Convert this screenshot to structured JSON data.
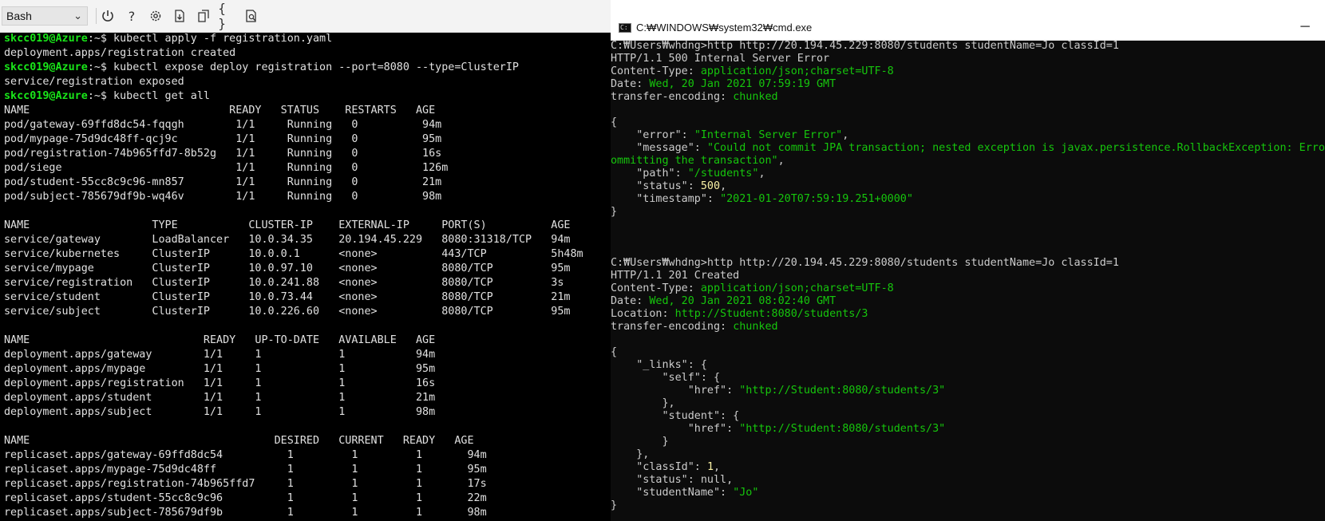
{
  "cloudshell": {
    "shell_select": "Bash",
    "toolbar_icons": [
      "power-icon",
      "help-icon",
      "settings-icon",
      "upload-download-icon",
      "open-new-session-icon",
      "editor-braces-icon",
      "web-preview-icon"
    ],
    "prompt_user": "skcc019@Azure",
    "prompt_path": ":~$ ",
    "lines": [
      {
        "type": "prompt",
        "cmd": "kubectl apply -f registration.yaml"
      },
      {
        "type": "out",
        "text": "deployment.apps/registration created"
      },
      {
        "type": "prompt",
        "cmd": "kubectl expose deploy registration --port=8080 --type=ClusterIP"
      },
      {
        "type": "out",
        "text": "service/registration exposed"
      },
      {
        "type": "prompt",
        "cmd": "kubectl get all"
      },
      {
        "type": "out",
        "text": "NAME                               READY   STATUS    RESTARTS   AGE"
      },
      {
        "type": "out",
        "text": "pod/gateway-69ffd8dc54-fqqgh        1/1     Running   0          94m"
      },
      {
        "type": "out",
        "text": "pod/mypage-75d9dc48ff-qcj9c         1/1     Running   0          95m"
      },
      {
        "type": "out",
        "text": "pod/registration-74b965ffd7-8b52g   1/1     Running   0          16s"
      },
      {
        "type": "out",
        "text": "pod/siege                           1/1     Running   0          126m"
      },
      {
        "type": "out",
        "text": "pod/student-55cc8c9c96-mn857        1/1     Running   0          21m"
      },
      {
        "type": "out",
        "text": "pod/subject-785679df9b-wq46v        1/1     Running   0          98m"
      },
      {
        "type": "out",
        "text": ""
      },
      {
        "type": "out",
        "text": "NAME                   TYPE           CLUSTER-IP    EXTERNAL-IP     PORT(S)          AGE"
      },
      {
        "type": "out",
        "text": "service/gateway        LoadBalancer   10.0.34.35    20.194.45.229   8080:31318/TCP   94m"
      },
      {
        "type": "out",
        "text": "service/kubernetes     ClusterIP      10.0.0.1      <none>          443/TCP          5h48m"
      },
      {
        "type": "out",
        "text": "service/mypage         ClusterIP      10.0.97.10    <none>          8080/TCP         95m"
      },
      {
        "type": "out",
        "text": "service/registration   ClusterIP      10.0.241.88   <none>          8080/TCP         3s"
      },
      {
        "type": "out",
        "text": "service/student        ClusterIP      10.0.73.44    <none>          8080/TCP         21m"
      },
      {
        "type": "out",
        "text": "service/subject        ClusterIP      10.0.226.60   <none>          8080/TCP         95m"
      },
      {
        "type": "out",
        "text": ""
      },
      {
        "type": "out",
        "text": "NAME                           READY   UP-TO-DATE   AVAILABLE   AGE"
      },
      {
        "type": "out",
        "text": "deployment.apps/gateway        1/1     1            1           94m"
      },
      {
        "type": "out",
        "text": "deployment.apps/mypage         1/1     1            1           95m"
      },
      {
        "type": "out",
        "text": "deployment.apps/registration   1/1     1            1           16s"
      },
      {
        "type": "out",
        "text": "deployment.apps/student        1/1     1            1           21m"
      },
      {
        "type": "out",
        "text": "deployment.apps/subject        1/1     1            1           98m"
      },
      {
        "type": "out",
        "text": ""
      },
      {
        "type": "out",
        "text": "NAME                                      DESIRED   CURRENT   READY   AGE"
      },
      {
        "type": "out",
        "text": "replicaset.apps/gateway-69ffd8dc54          1         1         1       94m"
      },
      {
        "type": "out",
        "text": "replicaset.apps/mypage-75d9dc48ff           1         1         1       95m"
      },
      {
        "type": "out",
        "text": "replicaset.apps/registration-74b965ffd7     1         1         1       17s"
      },
      {
        "type": "out",
        "text": "replicaset.apps/student-55cc8c9c96          1         1         1       22m"
      },
      {
        "type": "out",
        "text": "replicaset.apps/subject-785679df9b          1         1         1       98m"
      }
    ]
  },
  "cmd": {
    "title": "C:₩WINDOWS₩system32₩cmd.exe",
    "minimize": "─",
    "lines": [
      [
        {
          "c": "w",
          "t": "C:₩Users₩whdng>http http://20.194.45.229:8080/students studentName=Jo classId=1"
        }
      ],
      [
        {
          "c": "w",
          "t": "HTTP/1.1 500 Internal Server Error"
        }
      ],
      [
        {
          "c": "w",
          "t": "Content-Type: "
        },
        {
          "c": "g",
          "t": "application/json;charset=UTF-8"
        }
      ],
      [
        {
          "c": "w",
          "t": "Date: "
        },
        {
          "c": "g",
          "t": "Wed, 20 Jan 2021 07:59:19 GMT"
        }
      ],
      [
        {
          "c": "w",
          "t": "transfer-encoding: "
        },
        {
          "c": "g",
          "t": "chunked"
        }
      ],
      [
        {
          "c": "w",
          "t": ""
        }
      ],
      [
        {
          "c": "w",
          "t": "{"
        }
      ],
      [
        {
          "c": "w",
          "t": "    \"error\": "
        },
        {
          "c": "g",
          "t": "\"Internal Server Error\""
        },
        {
          "c": "w",
          "t": ","
        }
      ],
      [
        {
          "c": "w",
          "t": "    \"message\": "
        },
        {
          "c": "g",
          "t": "\"Could not commit JPA transaction; nested exception is javax.persistence.RollbackException: Error while c"
        }
      ],
      [
        {
          "c": "g",
          "t": "ommitting the transaction\""
        },
        {
          "c": "w",
          "t": ","
        }
      ],
      [
        {
          "c": "w",
          "t": "    \"path\": "
        },
        {
          "c": "g",
          "t": "\"/students\""
        },
        {
          "c": "w",
          "t": ","
        }
      ],
      [
        {
          "c": "w",
          "t": "    \"status\": "
        },
        {
          "c": "y",
          "t": "500"
        },
        {
          "c": "w",
          "t": ","
        }
      ],
      [
        {
          "c": "w",
          "t": "    \"timestamp\": "
        },
        {
          "c": "g",
          "t": "\"2021-01-20T07:59:19.251+0000\""
        }
      ],
      [
        {
          "c": "w",
          "t": "}"
        }
      ],
      [
        {
          "c": "w",
          "t": ""
        }
      ],
      [
        {
          "c": "w",
          "t": ""
        }
      ],
      [
        {
          "c": "w",
          "t": ""
        }
      ],
      [
        {
          "c": "w",
          "t": "C:₩Users₩whdng>http http://20.194.45.229:8080/students studentName=Jo classId=1"
        }
      ],
      [
        {
          "c": "w",
          "t": "HTTP/1.1 201 Created"
        }
      ],
      [
        {
          "c": "w",
          "t": "Content-Type: "
        },
        {
          "c": "g",
          "t": "application/json;charset=UTF-8"
        }
      ],
      [
        {
          "c": "w",
          "t": "Date: "
        },
        {
          "c": "g",
          "t": "Wed, 20 Jan 2021 08:02:40 GMT"
        }
      ],
      [
        {
          "c": "w",
          "t": "Location: "
        },
        {
          "c": "g",
          "t": "http://Student:8080/students/3"
        }
      ],
      [
        {
          "c": "w",
          "t": "transfer-encoding: "
        },
        {
          "c": "g",
          "t": "chunked"
        }
      ],
      [
        {
          "c": "w",
          "t": ""
        }
      ],
      [
        {
          "c": "w",
          "t": "{"
        }
      ],
      [
        {
          "c": "w",
          "t": "    \"_links\": {"
        }
      ],
      [
        {
          "c": "w",
          "t": "        \"self\": {"
        }
      ],
      [
        {
          "c": "w",
          "t": "            \"href\": "
        },
        {
          "c": "g",
          "t": "\"http://Student:8080/students/3\""
        }
      ],
      [
        {
          "c": "w",
          "t": "        },"
        }
      ],
      [
        {
          "c": "w",
          "t": "        \"student\": {"
        }
      ],
      [
        {
          "c": "w",
          "t": "            \"href\": "
        },
        {
          "c": "g",
          "t": "\"http://Student:8080/students/3\""
        }
      ],
      [
        {
          "c": "w",
          "t": "        }"
        }
      ],
      [
        {
          "c": "w",
          "t": "    },"
        }
      ],
      [
        {
          "c": "w",
          "t": "    \"classId\": "
        },
        {
          "c": "y",
          "t": "1"
        },
        {
          "c": "w",
          "t": ","
        }
      ],
      [
        {
          "c": "w",
          "t": "    \"status\": "
        },
        {
          "c": "w",
          "t": "null"
        },
        {
          "c": "w",
          "t": ","
        }
      ],
      [
        {
          "c": "w",
          "t": "    \"studentName\": "
        },
        {
          "c": "g",
          "t": "\"Jo\""
        }
      ],
      [
        {
          "c": "w",
          "t": "}"
        }
      ]
    ]
  }
}
